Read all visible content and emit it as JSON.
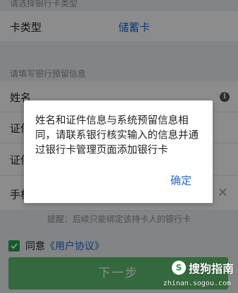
{
  "card_section": {
    "header": "请选择银行卡类型",
    "card_type_label": "卡类型",
    "card_type_value": "储蓄卡"
  },
  "info_section": {
    "header": "请填写银行预留信息",
    "fields": [
      {
        "label": "姓名",
        "icon": "info-icon"
      },
      {
        "label": "证件"
      },
      {
        "label": "证件"
      },
      {
        "label": "手机",
        "icon": "clear-icon"
      }
    ]
  },
  "tip": "提醒：后续只能绑定该持卡人的银行卡",
  "agreement": {
    "prefix": "同意",
    "link": "《用户协议》",
    "checked": true
  },
  "next_button": "下一步",
  "dialog": {
    "message": "姓名和证件信息与系统预留信息相同，请联系银行核实输入的信息并通过银行卡管理页面添加银行卡",
    "confirm": "确定"
  },
  "watermark": {
    "brand": "搜狗指南",
    "url": "zhinan.sogou.com"
  },
  "colors": {
    "accent_blue": "#1e6bd6",
    "button_green": "#5fc06f",
    "check_green": "#20a84a"
  }
}
